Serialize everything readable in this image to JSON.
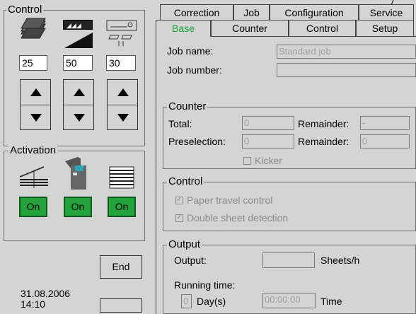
{
  "tabs_top": [
    {
      "label": "Correction"
    },
    {
      "label": "Job"
    },
    {
      "label": "Configuration"
    },
    {
      "label": "Service"
    }
  ],
  "tabs_bottom": [
    {
      "label": "Base",
      "active": true
    },
    {
      "label": "Counter"
    },
    {
      "label": "Control"
    },
    {
      "label": "Setup"
    }
  ],
  "left": {
    "control_title": "Control",
    "values": [
      "25",
      "50",
      "30"
    ],
    "activation_title": "Activation",
    "on_labels": [
      "On",
      "On",
      "On"
    ],
    "end_label": "End",
    "date": "31.08.2006",
    "time": "14:10"
  },
  "base": {
    "job_name_label": "Job name:",
    "job_name_value": "Standard job",
    "job_number_label": "Job number:",
    "job_number_value": "",
    "counter_title": "Counter",
    "total_label": "Total:",
    "total_value": "0",
    "remainder_label": "Remainder:",
    "remainder_value_1": "-",
    "preselection_label": "Preselection:",
    "preselection_value": "0",
    "remainder_value_2": "0",
    "kicker_label": "Kicker",
    "control_title": "Control",
    "paper_travel_label": "Paper travel control",
    "double_sheet_label": "Double sheet detection",
    "output_title": "Output",
    "output_label": "Output:",
    "output_value": "",
    "output_unit": "Sheets/h",
    "running_time_label": "Running time:",
    "days_value": "0",
    "days_label": "Day(s)",
    "time_value": "00:00:00",
    "time_label": "Time"
  },
  "colors": {
    "on_green": "#22a33c",
    "active_tab": "#1aa03a",
    "background": "#d4d4d4"
  }
}
